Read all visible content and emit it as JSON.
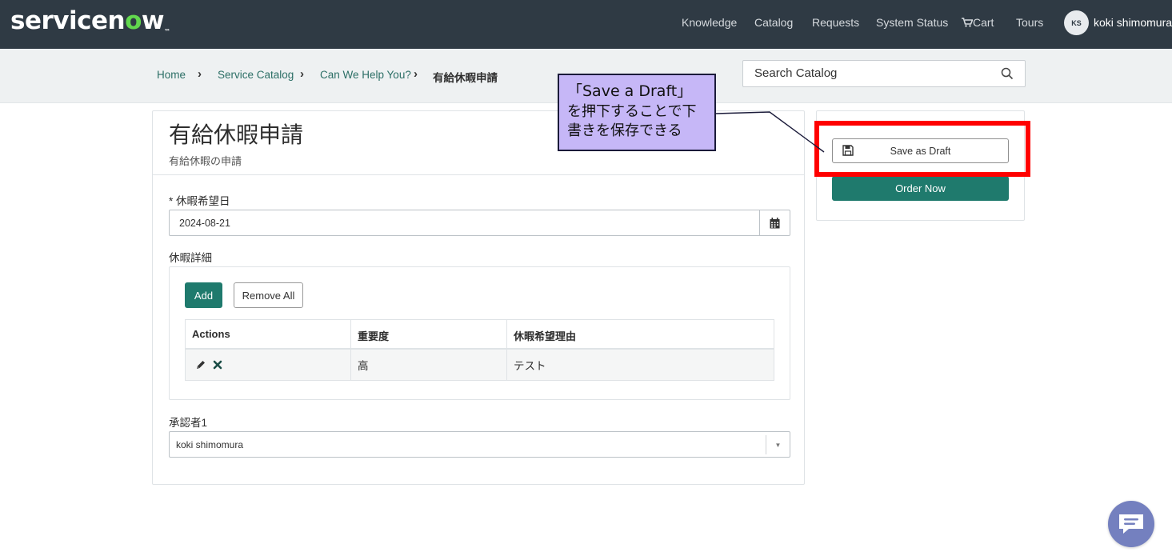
{
  "brand": {
    "logo_text_a": "servicen",
    "logo_text_o": "o",
    "logo_text_b": "w",
    "logo_tm": "™"
  },
  "nav": {
    "items": [
      "Knowledge",
      "Catalog",
      "Requests",
      "System Status",
      "Cart",
      "Tours"
    ]
  },
  "user": {
    "initials": "KS",
    "name": "koki shimomura"
  },
  "breadcrumb": {
    "items": [
      "Home",
      "Service Catalog",
      "Can We Help You?",
      "有給休暇申請"
    ]
  },
  "search": {
    "placeholder": "Search Catalog"
  },
  "form": {
    "title": "有給休暇申請",
    "subtitle": "有給休暇の申請",
    "date_label": "* 休暇希望日",
    "date_value": "2024-08-21",
    "details_label": "休暇詳細",
    "add_label": "Add",
    "remove_all_label": "Remove All",
    "table": {
      "headers": [
        "Actions",
        "重要度",
        "休暇希望理由"
      ],
      "rows": [
        {
          "importance": "高",
          "reason": "テスト"
        }
      ]
    },
    "approver_label": "承認者1",
    "approver_value": "koki shimomura"
  },
  "sidebar": {
    "save_draft_label": "Save as Draft",
    "order_now_label": "Order Now"
  },
  "annotation": {
    "line1": "「Save a Draft」",
    "line2": "を押下することで下書きを保存できる",
    "highlight_color": "#ff0000",
    "callout_color": "#c6b7f7"
  },
  "colors": {
    "topbar": "#2f3a44",
    "accent": "#1f7a6d",
    "logo_green": "#62d84e"
  }
}
